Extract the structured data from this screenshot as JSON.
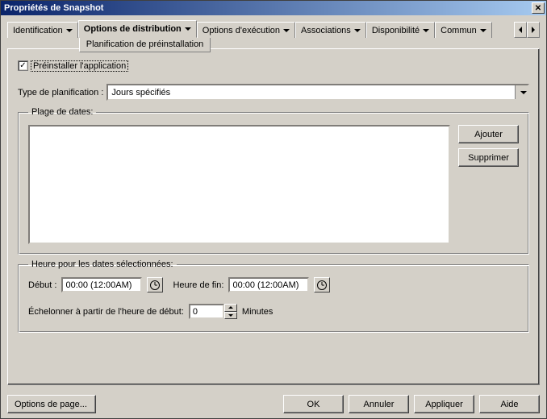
{
  "window": {
    "title": "Propriétés de Snapshot"
  },
  "tabs": {
    "identification": "Identification",
    "distribution": "Options de distribution",
    "distribution_sub": "Planification de préinstallation",
    "execution": "Options d'exécution",
    "associations": "Associations",
    "disponibilite": "Disponibilité",
    "commun": "Commun"
  },
  "preinstall": {
    "checkbox_label": "Préinstaller l'application",
    "checked": true
  },
  "schedule_type": {
    "label": "Type de planification :",
    "value": "Jours spécifiés"
  },
  "date_range": {
    "legend": "Plage de dates:",
    "add": "Ajouter",
    "remove": "Supprimer"
  },
  "time_group": {
    "legend": "Heure pour les dates sélectionnées:",
    "start_label": "Début :",
    "start_value": "00:00 (12:00AM)",
    "end_label": "Heure de fin:",
    "end_value": "00:00 (12:00AM)",
    "spread_label": "Échelonner à partir de l'heure de début:",
    "spread_value": "0",
    "spread_unit": "Minutes"
  },
  "buttons": {
    "page_options": "Options de page...",
    "ok": "OK",
    "cancel": "Annuler",
    "apply": "Appliquer",
    "help": "Aide"
  }
}
